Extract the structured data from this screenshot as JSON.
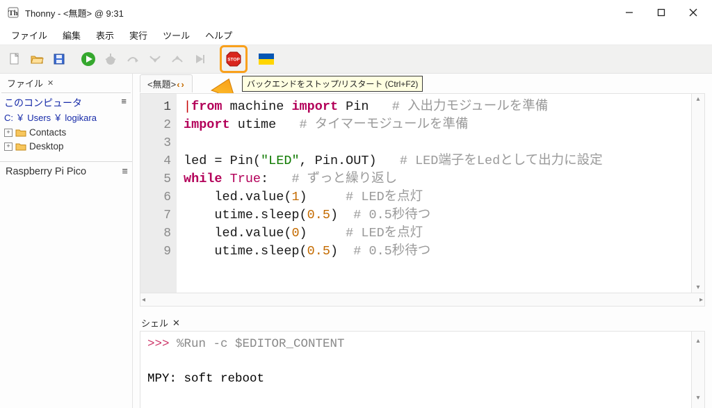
{
  "window": {
    "title": "Thonny  -  <無題>  @ 9:31"
  },
  "menu": {
    "file": "ファイル",
    "edit": "編集",
    "view": "表示",
    "run": "実行",
    "tools": "ツール",
    "help": "ヘルプ"
  },
  "tooltip": "バックエンドをストップ/リスタート (Ctrl+F2)",
  "sidebar": {
    "files_tab": "ファイル",
    "root_label": "このコンピュータ",
    "root_path": "C: ￥ Users ￥ logikara",
    "nodes": [
      "Contacts",
      "Desktop"
    ],
    "device_panel": "Raspberry Pi Pico"
  },
  "editor": {
    "tab_label": "無題",
    "lines": {
      "l1_from": "from",
      "l1_a": " machine ",
      "l1_import": "import",
      "l1_b": " Pin   ",
      "l1_c": "# 入出力モジュールを準備",
      "l2_import": "import",
      "l2_a": " utime   ",
      "l2_c": "# タイマーモジュールを準備",
      "l4_a": "led = Pin(",
      "l4_s": "\"LED\"",
      "l4_b": ", Pin.OUT)   ",
      "l4_c": "# LED端子をLedとして出力に設定",
      "l5_while": "while",
      "l5_sp": " ",
      "l5_true": "True",
      "l5_colon": ":   ",
      "l5_c": "# ずっと繰り返し",
      "l6_a": "    led.value(",
      "l6_n": "1",
      "l6_b": ")     ",
      "l6_c": "# LEDを点灯",
      "l7_a": "    utime.sleep(",
      "l7_n": "0.5",
      "l7_b": ")  ",
      "l7_c": "# 0.5秒待つ",
      "l8_a": "    led.value(",
      "l8_n": "0",
      "l8_b": ")     ",
      "l8_c": "# LEDを点灯",
      "l9_a": "    utime.sleep(",
      "l9_n": "0.5",
      "l9_b": ")  ",
      "l9_c": "# 0.5秒待つ"
    }
  },
  "shell": {
    "tab_label": "シェル",
    "prompt": ">>> ",
    "run_cmd": "%Run -c $EDITOR_CONTENT",
    "line2": "MPY: soft reboot"
  }
}
